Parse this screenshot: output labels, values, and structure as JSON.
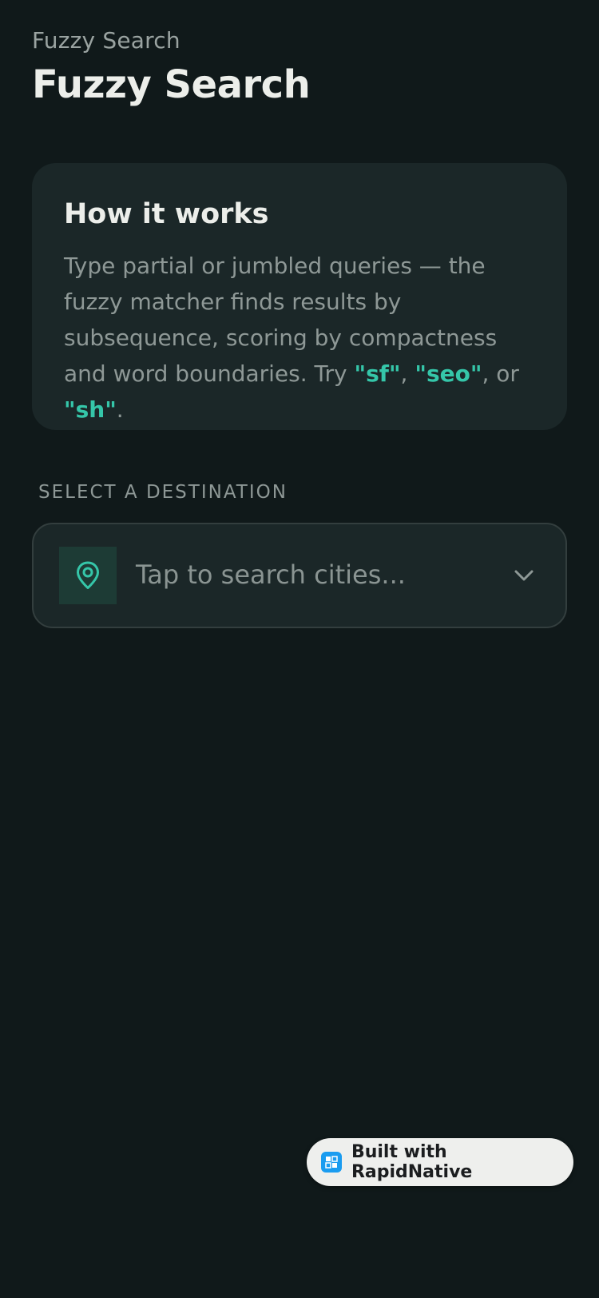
{
  "header": {
    "kicker": "Fuzzy Search",
    "title": "Fuzzy Search"
  },
  "info_card": {
    "title": "How it works",
    "body_intro": "Type partial or jumbled queries — the fuzzy matcher finds results by subsequence, scoring by compactness and word boundaries. Try ",
    "example_1": "\"sf\"",
    "sep_1": ", ",
    "example_2": "\"seo\"",
    "sep_2": ", or ",
    "example_3": "\"sh\"",
    "end": "."
  },
  "destination": {
    "label": "SELECT A DESTINATION",
    "placeholder": "Tap to search cities...",
    "icon": "map-pin-icon",
    "dropdown_icon": "chevron-down-icon"
  },
  "badge": {
    "label": "Built with RapidNative",
    "icon": "rapidnative-logo-icon"
  },
  "colors": {
    "background": "#10191a",
    "card": "#1b2728",
    "accent": "#35c6a9",
    "muted_text": "#8e9896"
  }
}
